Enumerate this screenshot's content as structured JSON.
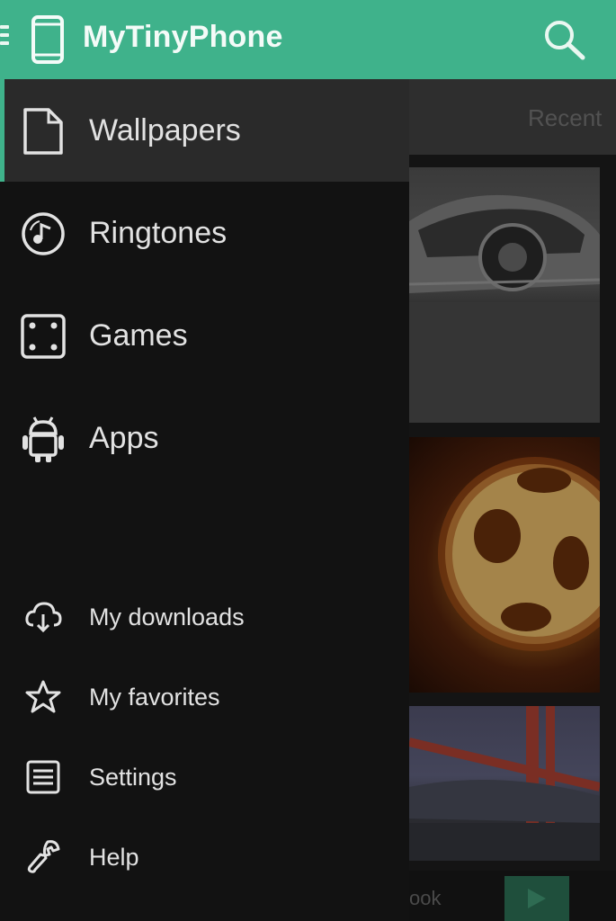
{
  "app_bar": {
    "title": "MyTinyPhone",
    "menu_icon": "hamburger-icon",
    "app_icon": "smartphone-icon",
    "search_icon": "search-icon",
    "color": "#3fb28b"
  },
  "drawer": {
    "main_items": [
      {
        "label": "Wallpapers",
        "icon": "document-icon",
        "selected": true
      },
      {
        "label": "Ringtones",
        "icon": "music-disc-icon",
        "selected": false
      },
      {
        "label": "Games",
        "icon": "dice-icon",
        "selected": false
      },
      {
        "label": "Apps",
        "icon": "android-icon",
        "selected": false
      }
    ],
    "secondary_items": [
      {
        "label": "My downloads",
        "icon": "cloud-download-icon"
      },
      {
        "label": "My favorites",
        "icon": "star-icon"
      },
      {
        "label": "Settings",
        "icon": "settings-panel-icon"
      },
      {
        "label": "Help",
        "icon": "wrench-icon"
      }
    ],
    "accent_color": "#3fb28b"
  },
  "background": {
    "tab_label": "Recent",
    "bottom_text": "ook"
  }
}
